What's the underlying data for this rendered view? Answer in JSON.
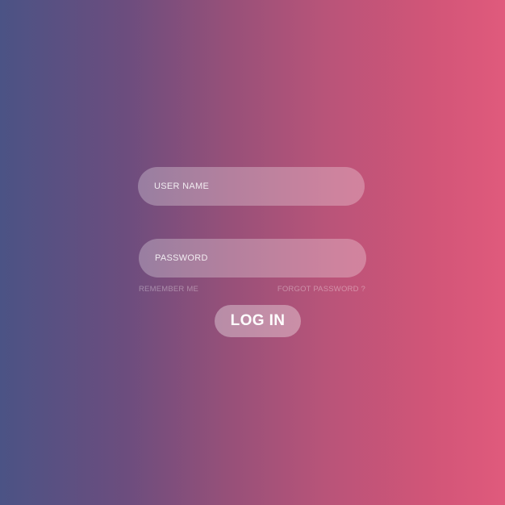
{
  "login_form": {
    "username_placeholder": "USER NAME",
    "password_placeholder": "PASSWORD",
    "remember_me_label": "REMEMBER ME",
    "forgot_password_label": "FORGOT PASSWORD ?",
    "login_button_label": "LOG IN"
  },
  "colors": {
    "gradient_left": "#4b5385",
    "gradient_right": "#e05a7c",
    "field_fill": "rgba(255,255,255,0.28)",
    "text": "#ffffff"
  }
}
